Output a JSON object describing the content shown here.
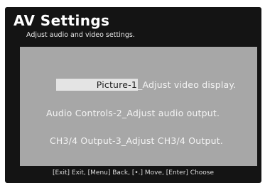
{
  "header": {
    "title": "AV Settings",
    "subtitle": "Adjust audio and video settings."
  },
  "menu": {
    "items": [
      {
        "label": "Picture-1",
        "description": "_Adjust video display.",
        "selected": true
      },
      {
        "label": "Audio Controls-2",
        "description": "_Adjust audio output.",
        "selected": false
      },
      {
        "label": "CH3/4 Output-3",
        "description": "_Adjust CH3/4 Output.",
        "selected": false
      }
    ]
  },
  "footer": {
    "exit_key": "[Exit]",
    "exit_label": " Exit, ",
    "menu_key": "[Menu]",
    "menu_label": " Back, ",
    "move_key": "[•.]",
    "move_label": " Move, ",
    "enter_key": "[Enter]",
    "enter_label": " Choose"
  },
  "colors": {
    "screen_background": "#141414",
    "panel_background": "#a7a7a7",
    "highlight": "#e4e4e4",
    "text": "#ffffff"
  }
}
